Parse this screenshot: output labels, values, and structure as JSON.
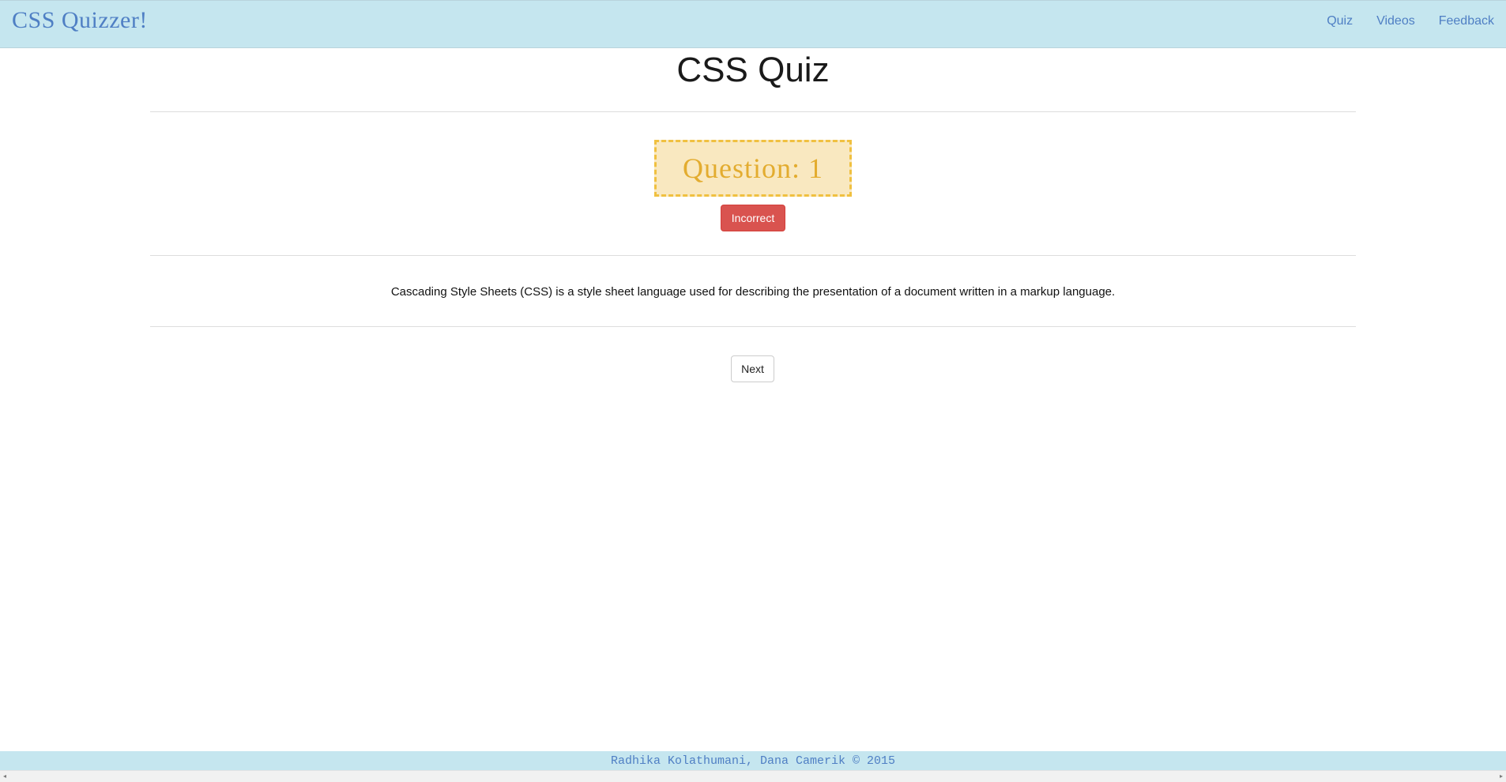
{
  "navbar": {
    "brand": "CSS Quizzer!",
    "links": [
      "Quiz",
      "Videos",
      "Feedback"
    ]
  },
  "main": {
    "title": "CSS Quiz",
    "question_label": "Question: 1",
    "result_label": "Incorrect",
    "answer_text": "Cascading Style Sheets (CSS) is a style sheet language used for describing the presentation of a document written in a markup language.",
    "next_label": "Next"
  },
  "footer": {
    "credits": "Radhika Kolathumani, Dana Camerik © 2015"
  },
  "scrollbar": {
    "left_arrow": "◂",
    "right_arrow": "▸"
  },
  "colors": {
    "nav_bg": "#c5e6ef",
    "link": "#4f7fc4",
    "question_bg": "#f9e8c0",
    "question_text": "#e3ac2f",
    "incorrect": "#d9534f"
  }
}
